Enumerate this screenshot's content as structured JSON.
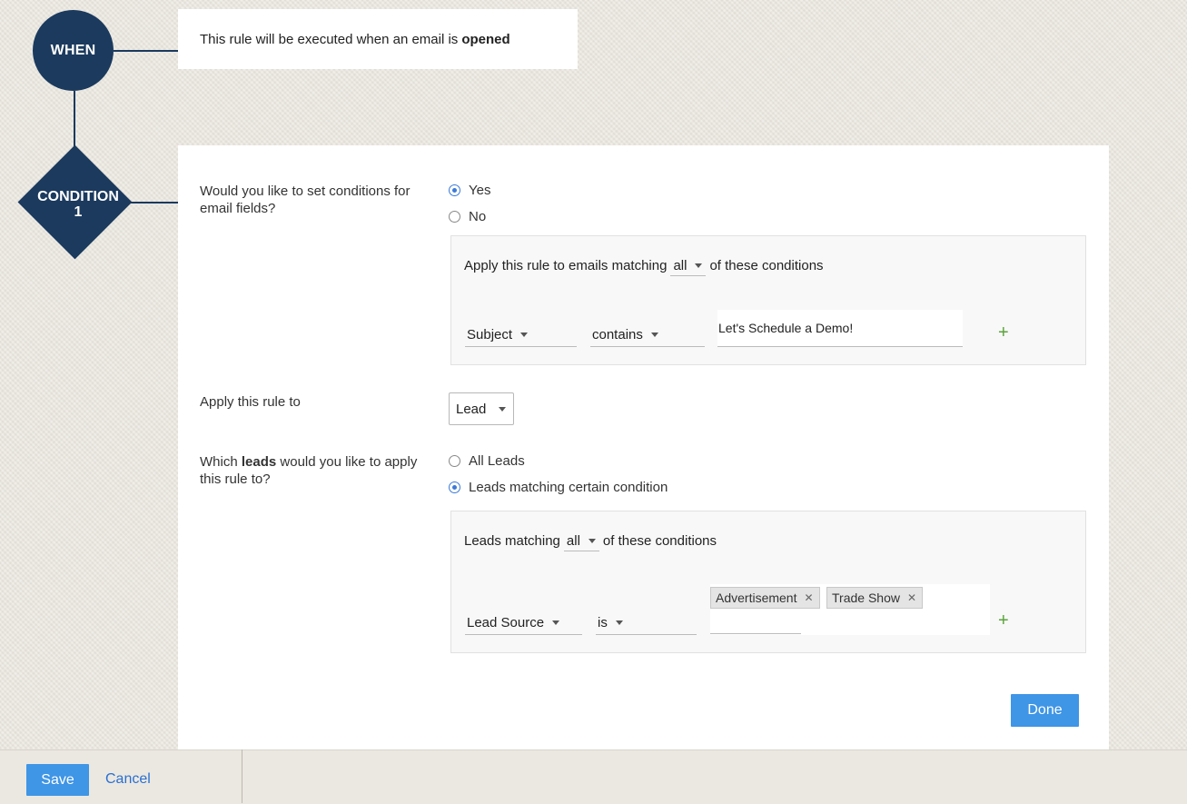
{
  "flow": {
    "when_label": "WHEN",
    "condition_label": "CONDITION",
    "condition_number": "1"
  },
  "when_box": {
    "text": "This rule will be executed when an email is",
    "event": "opened"
  },
  "email_conditions": {
    "question": "Would you like to set conditions for email fields?",
    "options": [
      "Yes",
      "No"
    ],
    "selected": "Yes",
    "match_prefix": "Apply this rule to emails matching",
    "match_mode": "all",
    "match_suffix": "of these conditions",
    "rule": {
      "field": "Subject",
      "operator": "contains",
      "value": "Let's Schedule a Demo!"
    },
    "add_symbol": "+"
  },
  "apply_rule": {
    "label": "Apply this rule to",
    "module": "Lead"
  },
  "lead_scope": {
    "question_prefix": "Which",
    "question_bold": "leads",
    "question_suffix": "would you like to apply this rule to?",
    "options": [
      "All Leads",
      "Leads matching certain condition"
    ],
    "selected": "Leads matching certain condition",
    "match_prefix": "Leads matching",
    "match_mode": "all",
    "match_suffix": "of these conditions",
    "rule": {
      "field": "Lead Source",
      "operator": "is",
      "tags": [
        "Advertisement",
        "Trade Show"
      ]
    },
    "add_symbol": "+"
  },
  "done_label": "Done",
  "footer": {
    "save_label": "Save",
    "cancel_label": "Cancel"
  },
  "colors": {
    "node": "#1b3a5e",
    "accent": "#3f95e6",
    "link": "#2a6fd1",
    "plus": "#5aa33a"
  }
}
